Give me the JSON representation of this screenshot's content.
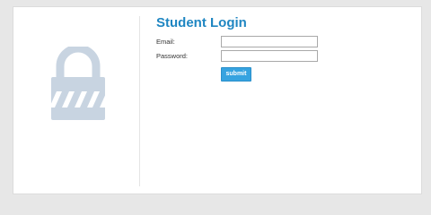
{
  "login": {
    "title": "Student Login",
    "email_label": "Email:",
    "email_value": "",
    "password_label": "Password:",
    "password_value": "",
    "submit_label": "submit"
  },
  "icons": {
    "illustration": "lock-icon"
  },
  "colors": {
    "page_background": "#e7e7e7",
    "card_background": "#ffffff",
    "title": "#1f86c2",
    "button": "#36a3e0",
    "lock_icon": "#c8d4e1"
  }
}
